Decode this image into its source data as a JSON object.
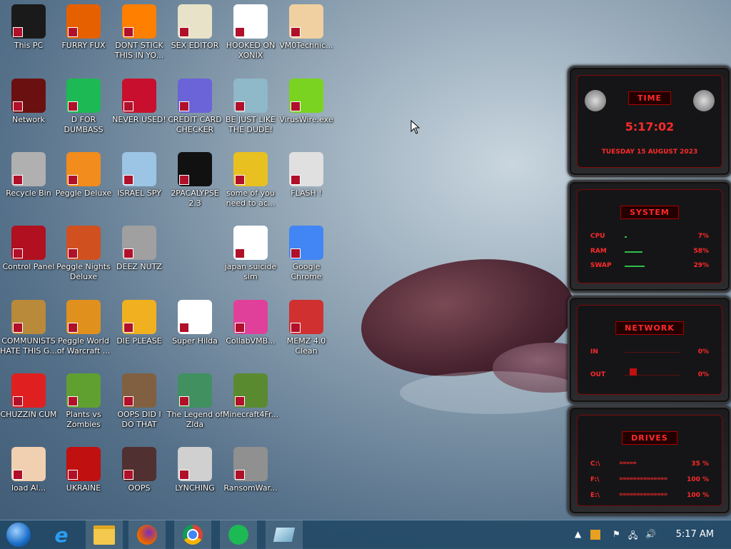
{
  "desktop_icons": [
    {
      "label": "This PC",
      "icon": "computer-icon",
      "bg": "#1a1a1a"
    },
    {
      "label": "FURRY FUX",
      "icon": "firefox-icon",
      "bg": "#e66000"
    },
    {
      "label": "DONT STICK THIS IN YO...",
      "icon": "traffic-cone-icon",
      "bg": "#ff7f00"
    },
    {
      "label": "SEX EDITOR",
      "icon": "hex-editor-icon",
      "bg": "#e8e2c8"
    },
    {
      "label": "HOOKED ON XONIX",
      "icon": "xonix-icon",
      "bg": "#ffffff"
    },
    {
      "label": "VM0Technic...",
      "icon": "doctor-icon",
      "bg": "#f0d0a0"
    },
    {
      "label": "Network",
      "icon": "network-icon",
      "bg": "#6b1010"
    },
    {
      "label": "D FOR DUMBASS",
      "icon": "spotify-icon",
      "bg": "#1db954"
    },
    {
      "label": "NEVER USED!",
      "icon": "devcpp-icon",
      "bg": "#c8102e"
    },
    {
      "label": "CREDIT CARD CHECKER",
      "icon": "credit-card-icon",
      "bg": "#6b63d8"
    },
    {
      "label": "BE JUST LIKE THE DUDE!",
      "icon": "santa-icon",
      "bg": "#8fb8c8"
    },
    {
      "label": "VirusWire.exe",
      "icon": "lime-icon",
      "bg": "#7ad320"
    },
    {
      "label": "Recycle Bin",
      "icon": "recycle-bin-icon",
      "bg": "#b0b0b0"
    },
    {
      "label": "Peggle Deluxe",
      "icon": "peggle-icon",
      "bg": "#f28c1c"
    },
    {
      "label": "ISRAEL SPY",
      "icon": "network-pc-icon",
      "bg": "#9cc4e4"
    },
    {
      "label": "2PACALYPSE 2.3",
      "icon": "terminal-icon",
      "bg": "#111111"
    },
    {
      "label": "some of you need to ac...",
      "icon": "dog-icon",
      "bg": "#e8c020"
    },
    {
      "label": "FLASH !",
      "icon": "flash-icon",
      "bg": "#e0e0e0"
    },
    {
      "label": "Control Panel",
      "icon": "control-panel-icon",
      "bg": "#b01020"
    },
    {
      "label": "Peggle Nights Deluxe",
      "icon": "peggle-nights-icon",
      "bg": "#d05020"
    },
    {
      "label": "DEEZ NUTZ",
      "icon": "windows-stack-icon",
      "bg": "#a0a0a0"
    },
    {
      "label": "",
      "icon": "",
      "bg": ""
    },
    {
      "label": "japan suicide sim",
      "icon": "suicide-sim-icon",
      "bg": "#ffffff"
    },
    {
      "label": "Google Chrome",
      "icon": "chrome-icon",
      "bg": "#4285f4"
    },
    {
      "label": "COMMUNISTS HATE THIS G...",
      "icon": "money-bag-icon",
      "bg": "#b88a3a"
    },
    {
      "label": "Peggle World of Warcraft ...",
      "icon": "peggle-wow-icon",
      "bg": "#e0901c"
    },
    {
      "label": "DIE PLEASE",
      "icon": "de-icon",
      "bg": "#f0b020"
    },
    {
      "label": "Super Hilda",
      "icon": "pixel-dog-icon",
      "bg": "#ffffff"
    },
    {
      "label": "CollabVMB...",
      "icon": "collabvm-icon",
      "bg": "#e0409a"
    },
    {
      "label": "MEMZ 4.0 Clean",
      "icon": "memz-icon",
      "bg": "#d03030"
    },
    {
      "label": "CHUZZIN CUM",
      "icon": "chuzzle-icon",
      "bg": "#e02020"
    },
    {
      "label": "Plants vs Zombies",
      "icon": "pvz-icon",
      "bg": "#60a030"
    },
    {
      "label": "OOPS DID I DO THAT",
      "icon": "portrait-icon",
      "bg": "#806040"
    },
    {
      "label": "The Legend of Zlda",
      "icon": "zelda-icon",
      "bg": "#409060"
    },
    {
      "label": "Minecraft4Fr...",
      "icon": "minecraft-icon",
      "bg": "#5a8a30"
    },
    {
      "label": "",
      "icon": "",
      "bg": ""
    },
    {
      "label": "load Al...",
      "icon": "star-butterfly-icon",
      "bg": "#f0d0b0"
    },
    {
      "label": "UKRAINE",
      "icon": "radiation-icon",
      "bg": "#c01010"
    },
    {
      "label": "OOPS",
      "icon": "oops-icon",
      "bg": "#503030"
    },
    {
      "label": "LYNCHING",
      "icon": "russia-icon",
      "bg": "#d0d0d0"
    },
    {
      "label": "RansomWar...",
      "icon": "skull-icon",
      "bg": "#909090"
    }
  ],
  "widgets": {
    "time": {
      "title": "TIME",
      "time": "5:17:02",
      "date": "TUESDAY 15 AUGUST 2023"
    },
    "system": {
      "title": "SYSTEM",
      "rows": [
        {
          "name": "CPU",
          "value": "7%",
          "pct": 7
        },
        {
          "name": "RAM",
          "value": "58%",
          "pct": 58
        },
        {
          "name": "SWAP",
          "value": "29%",
          "pct": 29
        }
      ]
    },
    "network": {
      "title": "NETWORK",
      "rows": [
        {
          "name": "IN",
          "value": "0%"
        },
        {
          "name": "OUT",
          "value": "0%"
        }
      ]
    },
    "drives": {
      "title": "DRIVES",
      "rows": [
        {
          "name": "C:\\",
          "chevrons": "»»»»»",
          "value": "35 %"
        },
        {
          "name": "F:\\",
          "chevrons": "»»»»»»»»»»»»»»",
          "value": "100 %"
        },
        {
          "name": "E:\\",
          "chevrons": "»»»»»»»»»»»»»»",
          "value": "100 %"
        }
      ]
    }
  },
  "taskbar": {
    "clock": "5:17 AM"
  },
  "colors": {
    "accent": "#ff2a2a"
  }
}
